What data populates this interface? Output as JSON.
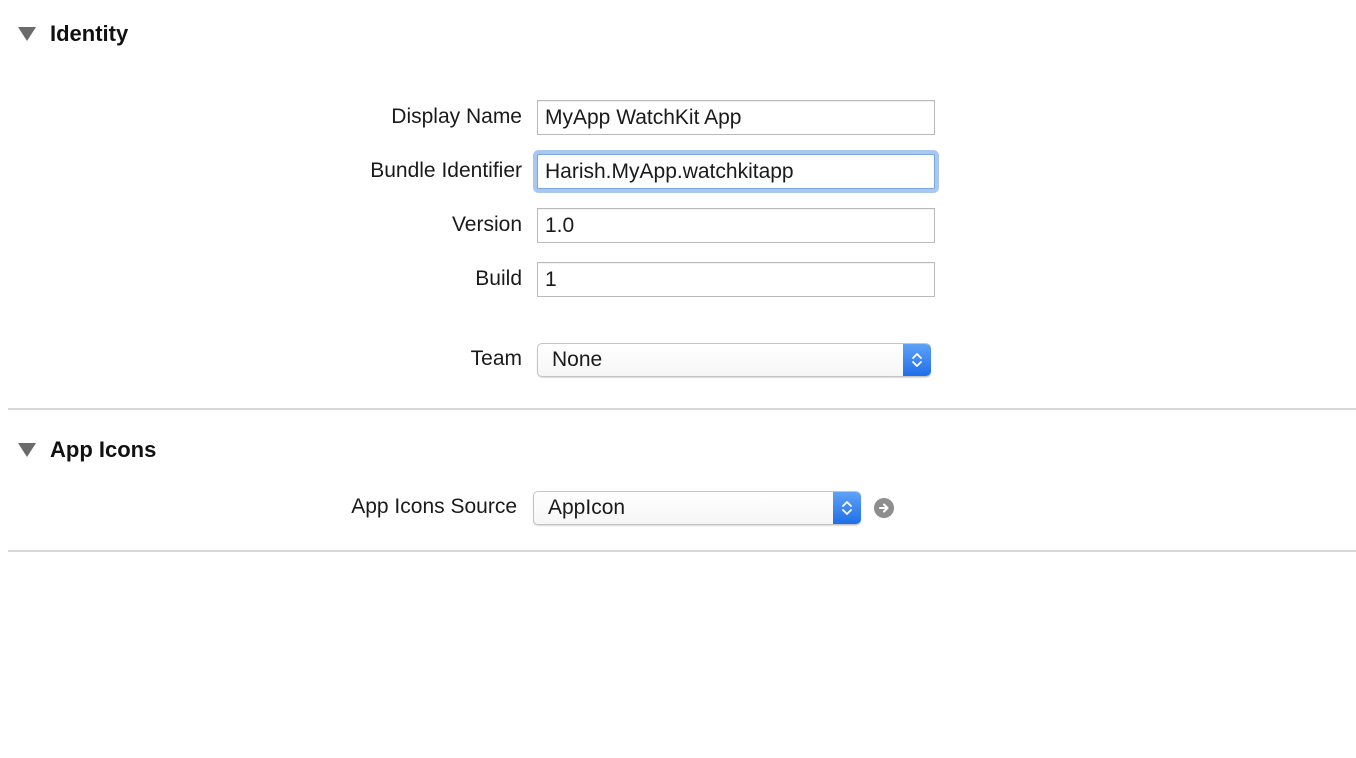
{
  "identity": {
    "title": "Identity",
    "display_name_label": "Display Name",
    "display_name_value": "MyApp WatchKit App",
    "bundle_identifier_label": "Bundle Identifier",
    "bundle_identifier_value": "Harish.MyApp.watchkitapp",
    "version_label": "Version",
    "version_value": "1.0",
    "build_label": "Build",
    "build_value": "1",
    "team_label": "Team",
    "team_value": "None"
  },
  "app_icons": {
    "title": "App Icons",
    "source_label": "App Icons Source",
    "source_value": "AppIcon"
  },
  "colors": {
    "focus_ring": "#a9c8f0",
    "popup_accent": "#1f6fe8",
    "separator": "#d8d8d8"
  },
  "icons": {
    "disclosure": "disclosure-triangle-down-icon",
    "popup": "up-down-chevron-icon",
    "navigate": "arrow-right-circle-icon"
  }
}
